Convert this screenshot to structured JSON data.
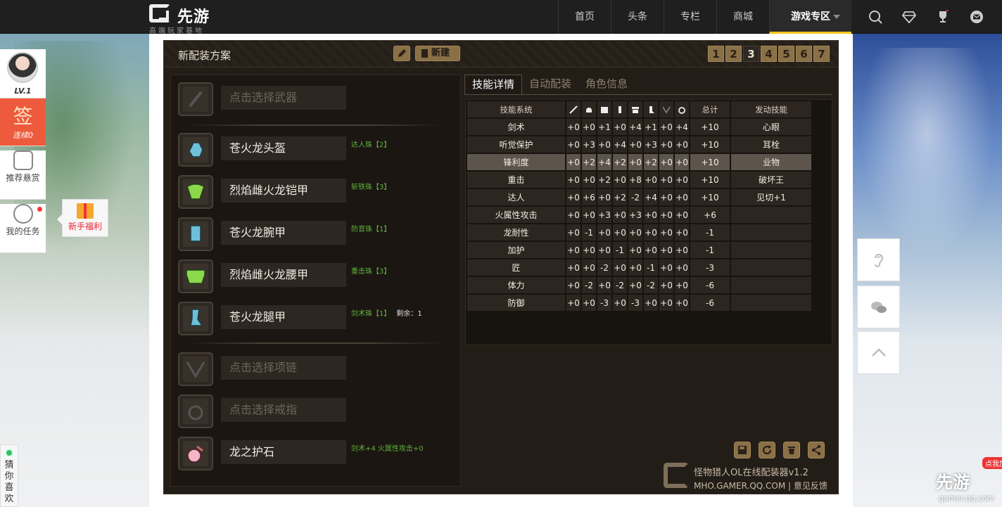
{
  "nav": {
    "logo_title": "先游",
    "logo_subtitle": "高端玩家基地",
    "links": [
      "首页",
      "头条",
      "专栏",
      "商城",
      "游戏专区"
    ],
    "icons": [
      "search-icon",
      "diamond-icon",
      "trophy-icon",
      "mail-icon"
    ]
  },
  "left_sidebar": {
    "level": "LV.1",
    "sign_char": "签",
    "sign_sub": "连续0",
    "reward_label": "推荐悬赏",
    "task_label": "我的任务",
    "welfare_label": "新手福利",
    "guess_label": "猜你喜欢"
  },
  "right_brand": {
    "text": "先游",
    "url": "gamer.qq.com",
    "tag": "点我加"
  },
  "panel": {
    "title": "新配装方案",
    "new_label": "新建",
    "pages": [
      "1",
      "2",
      "3",
      "4",
      "5",
      "6",
      "7"
    ],
    "active_page": "3"
  },
  "equipment": {
    "weapon": {
      "name": "点击选择武器",
      "icon": "sword-icon"
    },
    "armor": [
      {
        "name": "苍火龙头盔",
        "jewel": "达人珠【2】",
        "extra": "",
        "icon": "helmet-icon"
      },
      {
        "name": "烈焰雌火龙铠甲",
        "jewel": "斩铁珠【3】",
        "extra": "",
        "icon": "chest-armor-icon"
      },
      {
        "name": "苍火龙腕甲",
        "jewel": "防音珠【1】",
        "extra": "",
        "icon": "gauntlet-icon"
      },
      {
        "name": "烈焰雌火龙腰甲",
        "jewel": "重击珠【3】",
        "extra": "",
        "icon": "waist-armor-icon"
      },
      {
        "name": "苍火龙腿甲",
        "jewel": "剑术珠【1】",
        "extra": "剩余：1",
        "icon": "leg-armor-icon"
      }
    ],
    "accessories": [
      {
        "name": "点击选择项链",
        "jewel": "",
        "icon": "necklace-icon"
      },
      {
        "name": "点击选择戒指",
        "jewel": "",
        "icon": "ring-icon"
      },
      {
        "name": "龙之护石",
        "jewel": "剑术+4  火属性攻击+0",
        "icon": "talisman-icon"
      }
    ]
  },
  "tabs": [
    "技能详情",
    "自动配装",
    "角色信息"
  ],
  "skills": {
    "header_name": "技能系统",
    "header_total": "总计",
    "header_active": "发动技能",
    "slot_icons": [
      "weapon-slot-icon",
      "helmet-slot-icon",
      "chest-slot-icon",
      "arm-slot-icon",
      "waist-slot-icon",
      "leg-slot-icon",
      "necklace-slot-icon",
      "ring-slot-icon"
    ],
    "rows": [
      {
        "name": "剑术",
        "vals": [
          "+0",
          "+0",
          "+1",
          "+0",
          "+4",
          "+1",
          "+0",
          "+4"
        ],
        "total": "+10",
        "active": "心眼"
      },
      {
        "name": "听觉保护",
        "vals": [
          "+0",
          "+3",
          "+0",
          "+4",
          "+0",
          "+3",
          "+0",
          "+0"
        ],
        "total": "+10",
        "active": "耳栓"
      },
      {
        "name": "锋利度",
        "vals": [
          "+0",
          "+2",
          "+4",
          "+2",
          "+0",
          "+2",
          "+0",
          "+0"
        ],
        "total": "+10",
        "active": "业物"
      },
      {
        "name": "重击",
        "vals": [
          "+0",
          "+0",
          "+2",
          "+0",
          "+8",
          "+0",
          "+0",
          "+0"
        ],
        "total": "+10",
        "active": "破坏王"
      },
      {
        "name": "达人",
        "vals": [
          "+0",
          "+6",
          "+0",
          "+2",
          "-2",
          "+4",
          "+0",
          "+0"
        ],
        "total": "+10",
        "active": "见切+1"
      },
      {
        "name": "火属性攻击",
        "vals": [
          "+0",
          "+0",
          "+3",
          "+0",
          "+3",
          "+0",
          "+0",
          "+0"
        ],
        "total": "+6",
        "active": ""
      },
      {
        "name": "龙耐性",
        "vals": [
          "+0",
          "-1",
          "+0",
          "+0",
          "+0",
          "+0",
          "+0",
          "+0"
        ],
        "total": "-1",
        "active": ""
      },
      {
        "name": "加护",
        "vals": [
          "+0",
          "+0",
          "+0",
          "-1",
          "+0",
          "+0",
          "+0",
          "+0"
        ],
        "total": "-1",
        "active": ""
      },
      {
        "name": "匠",
        "vals": [
          "+0",
          "+0",
          "-2",
          "+0",
          "+0",
          "-1",
          "+0",
          "+0"
        ],
        "total": "-3",
        "active": ""
      },
      {
        "name": "体力",
        "vals": [
          "+0",
          "-2",
          "+0",
          "-2",
          "+0",
          "-2",
          "+0",
          "+0"
        ],
        "total": "-6",
        "active": ""
      },
      {
        "name": "防御",
        "vals": [
          "+0",
          "+0",
          "-3",
          "+0",
          "-3",
          "+0",
          "+0",
          "+0"
        ],
        "total": "-6",
        "active": ""
      }
    ],
    "highlighted_row": "锋利度"
  },
  "footer": {
    "app_name": "怪物猎人OL在线配装器v1.2",
    "url": "MHO.GAMER.QQ.COM",
    "separator": " | ",
    "feedback": "意见反馈",
    "tools": [
      "save-icon",
      "refresh-icon",
      "trash-icon",
      "share-icon"
    ]
  }
}
